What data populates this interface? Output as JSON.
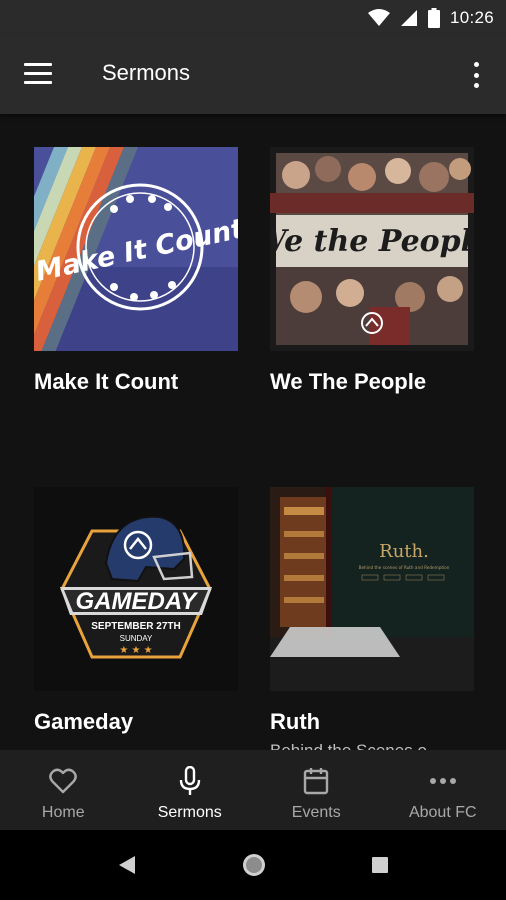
{
  "status_bar": {
    "time": "10:26"
  },
  "app_bar": {
    "title": "Sermons"
  },
  "sermons": [
    {
      "title": "Make It Count",
      "subtitle": "",
      "art_text": "Make It Count"
    },
    {
      "title": "We The People",
      "subtitle": "",
      "art_text": "We the People"
    },
    {
      "title": "Gameday",
      "subtitle": "",
      "art_text": "GAMEDAY",
      "art_date": "SEPTEMBER 27TH",
      "art_day": "SUNDAY"
    },
    {
      "title": "Ruth",
      "subtitle": "Behind the Scenes o",
      "art_text": "Ruth.",
      "art_tagline": "Behind the scenes of Ruth and Redemption"
    }
  ],
  "bottom_nav": [
    {
      "label": "Home",
      "icon": "heart-icon",
      "active": false
    },
    {
      "label": "Sermons",
      "icon": "microphone-icon",
      "active": true
    },
    {
      "label": "Events",
      "icon": "calendar-icon",
      "active": false
    },
    {
      "label": "About FC",
      "icon": "more-horizontal-icon",
      "active": false
    }
  ],
  "colors": {
    "background": "#121212",
    "app_bar": "#2b2b2b",
    "bottom_nav": "#1f1f1f",
    "inactive_label": "#a8a8a8"
  }
}
